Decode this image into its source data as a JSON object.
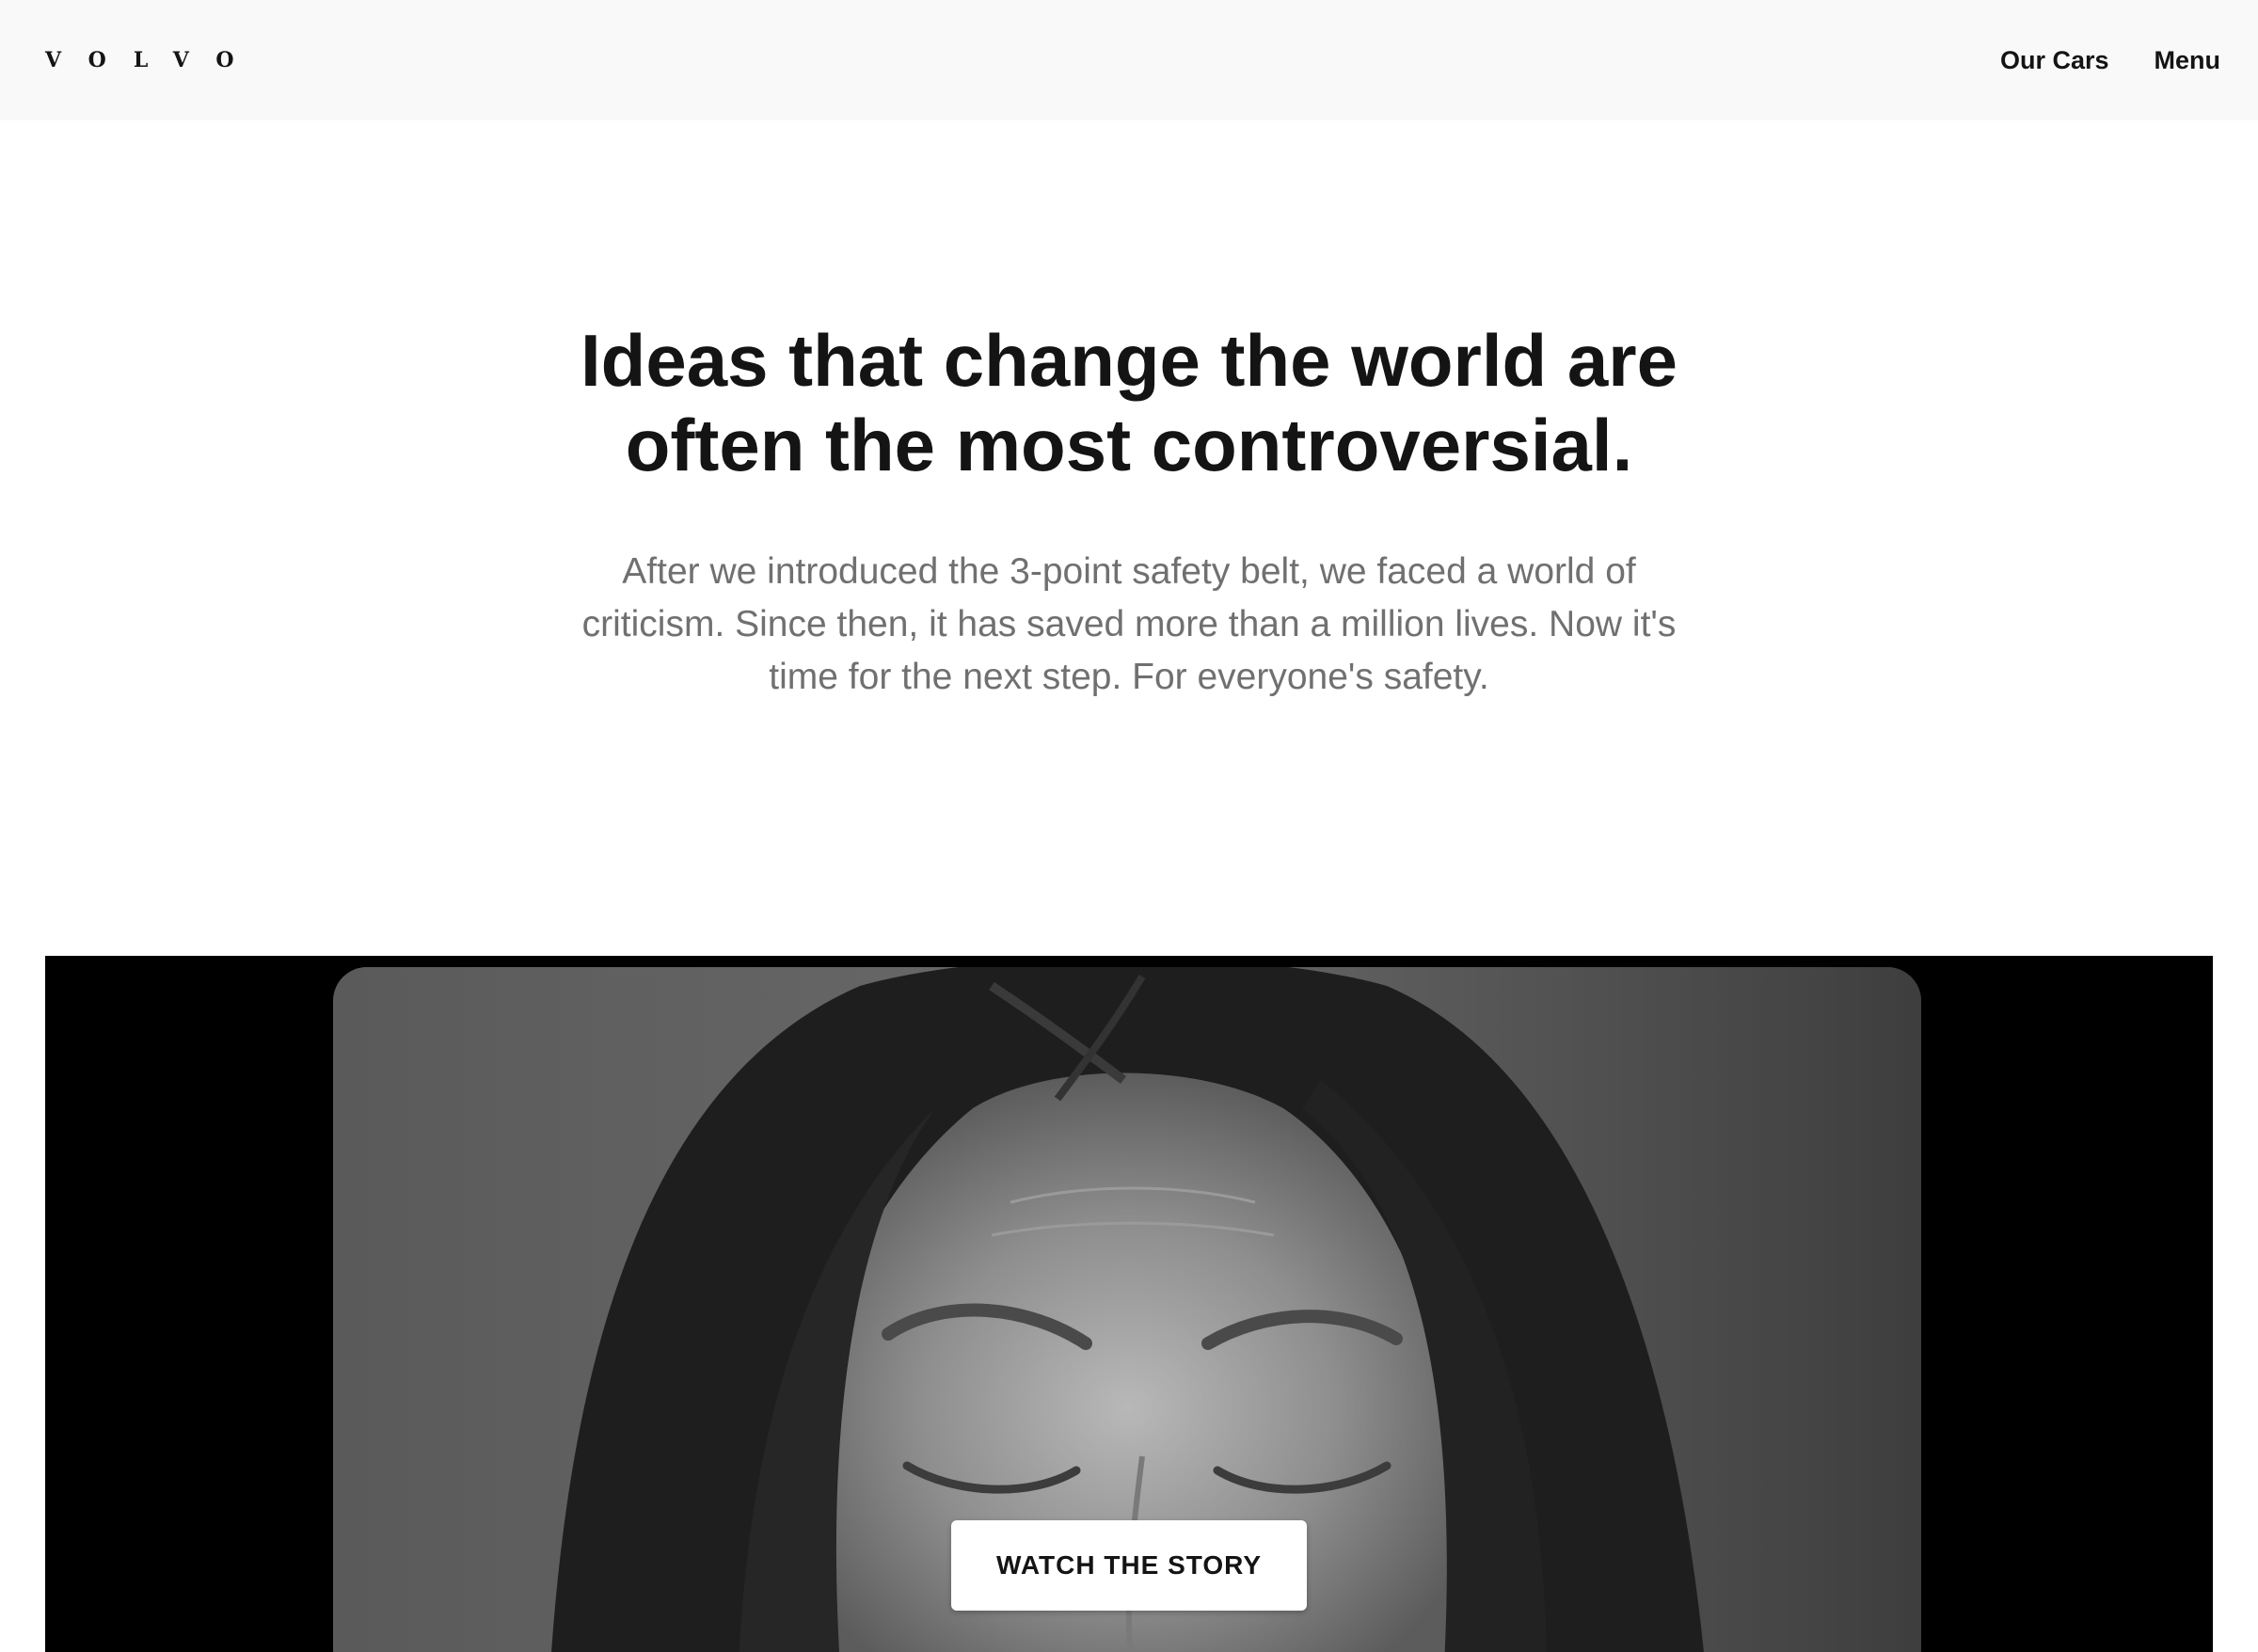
{
  "header": {
    "logo_text": "VOLVO",
    "nav": {
      "our_cars": "Our Cars",
      "menu": "Menu"
    }
  },
  "intro": {
    "headline_line1": "Ideas that change the world are",
    "headline_line2": "often the most controversial.",
    "lede_line1": "After we introduced the 3-point safety belt, we faced a world of",
    "lede_line2": "criticism. Since then, it has saved more than a million lives. Now it's",
    "lede_line3": "time for the next step. For everyone's safety."
  },
  "video": {
    "cta_label": "WATCH THE STORY",
    "style": "black-and-white"
  },
  "colors": {
    "header_bg": "#f9f9f9",
    "headline": "#141414",
    "lede": "#707070",
    "video_bg": "#000000",
    "button_bg": "#ffffff"
  }
}
